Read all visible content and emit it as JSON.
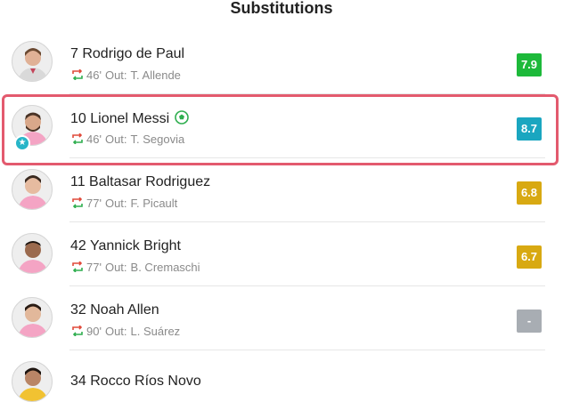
{
  "header": {
    "title": "Substitutions"
  },
  "substitutions": [
    {
      "number_name": "7 Rodrigo de Paul",
      "minute": "46'",
      "out_label": "Out:",
      "out_player": "T. Allende",
      "rating": "7.9",
      "rating_color": "#1db93a",
      "goal": false,
      "star": false,
      "shirt": "#d9d9d9",
      "skin": "#e0b196",
      "hair": "#6b4a32"
    },
    {
      "number_name": "10 Lionel Messi",
      "minute": "46'",
      "out_label": "Out:",
      "out_player": "T. Segovia",
      "rating": "8.7",
      "rating_color": "#1aa6c0",
      "goal": true,
      "star": true,
      "shirt": "#f4a4c4",
      "skin": "#d9a88a",
      "hair": "#4a3426"
    },
    {
      "number_name": "11 Baltasar Rodriguez",
      "minute": "77'",
      "out_label": "Out:",
      "out_player": "F. Picault",
      "rating": "6.8",
      "rating_color": "#d8a912",
      "goal": false,
      "star": false,
      "shirt": "#f4a4c4",
      "skin": "#e6bba0",
      "hair": "#3a2a20"
    },
    {
      "number_name": "42 Yannick Bright",
      "minute": "77'",
      "out_label": "Out:",
      "out_player": "B. Cremaschi",
      "rating": "6.7",
      "rating_color": "#d8a912",
      "goal": false,
      "star": false,
      "shirt": "#f4a4c4",
      "skin": "#9b6a4e",
      "hair": "#1e1510"
    },
    {
      "number_name": "32 Noah Allen",
      "minute": "90'",
      "out_label": "Out:",
      "out_player": "L. Suárez",
      "rating": "-",
      "rating_color": "#a8adb3",
      "goal": false,
      "star": false,
      "shirt": "#f4a4c4",
      "skin": "#e2b89b",
      "hair": "#2a1c14"
    },
    {
      "number_name": "34 Rocco Ríos Novo",
      "minute": "",
      "out_label": "",
      "out_player": "",
      "rating": "",
      "rating_color": "",
      "goal": false,
      "star": false,
      "shirt": "#f1c232",
      "skin": "#b98566",
      "hair": "#1e1510"
    }
  ],
  "colors": {
    "highlight": "#e35a6e",
    "swap_up": "#e04a3a",
    "swap_down": "#2fae4f"
  },
  "icons": {
    "swap": "swap-arrows-icon",
    "goal": "football-icon",
    "star": "star-icon"
  }
}
